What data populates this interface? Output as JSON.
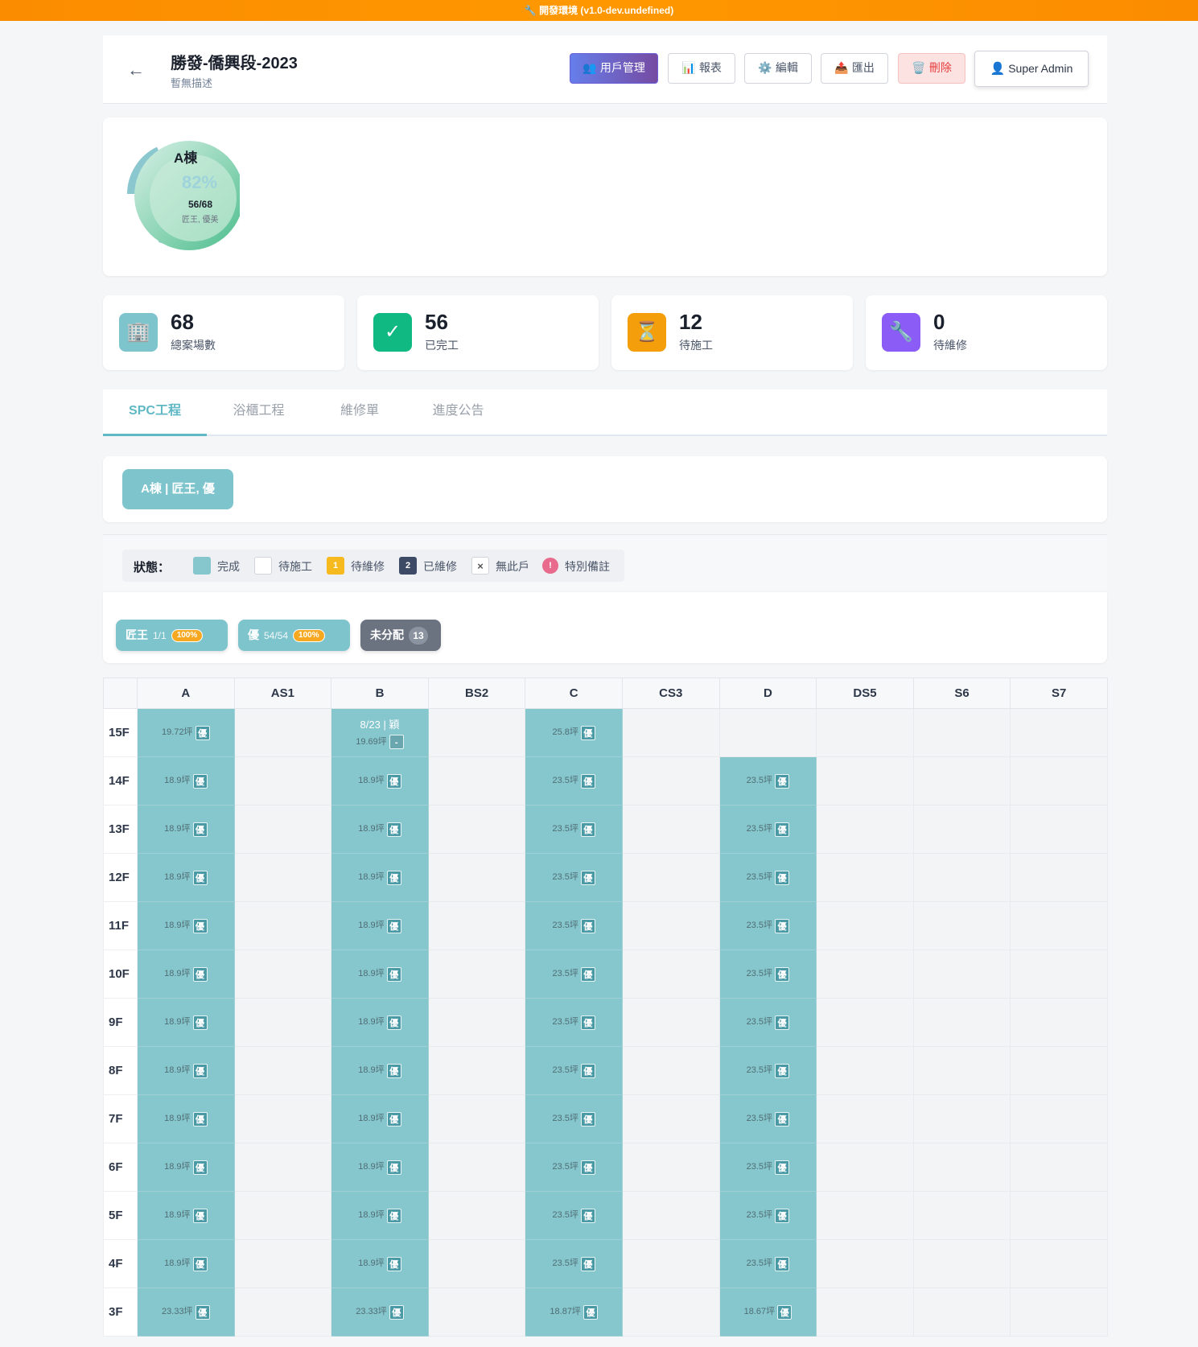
{
  "env_banner": "🔧 開發環境 (v1.0-dev.undefined)",
  "header": {
    "back": "←",
    "title": "勝發-僑興段-2023",
    "subtitle": "暫無描述",
    "buttons": {
      "users": "👥 用戶管理",
      "report": "📊 報表",
      "edit": "⚙️ 編輯",
      "export": "📤 匯出",
      "delete": "🗑️ 刪除",
      "admin_icon": "👤",
      "admin": "Super Admin"
    }
  },
  "building_card": {
    "name": "A棟",
    "percent": "82%",
    "count": "56/68",
    "teams": "匠王, 優美"
  },
  "stats": [
    {
      "icon": "🏢",
      "value": "68",
      "label": "總案場數",
      "color": "#7ec4cc"
    },
    {
      "icon": "✓",
      "value": "56",
      "label": "已完工",
      "color": "#10b981"
    },
    {
      "icon": "⏳",
      "value": "12",
      "label": "待施工",
      "color": "#f59e0b"
    },
    {
      "icon": "🔧",
      "value": "0",
      "label": "待維修",
      "color": "#8b5cf6"
    }
  ],
  "tabs": [
    "SPC工程",
    "浴櫃工程",
    "維修單",
    "進度公告"
  ],
  "building_selector": "A棟 | 匠王, 優",
  "legend": {
    "title": "狀態：",
    "items": [
      {
        "label": "完成"
      },
      {
        "label": "待施工"
      },
      {
        "label": "待維修",
        "mark": "1"
      },
      {
        "label": "已維修",
        "mark": "2"
      },
      {
        "label": "無此戶",
        "mark": "×"
      },
      {
        "label": "特別備註",
        "mark": "!"
      }
    ]
  },
  "teams": [
    {
      "name": "匠王",
      "count": "1/1",
      "percent": "100%"
    },
    {
      "name": "優",
      "count": "54/54",
      "percent": "100%"
    },
    {
      "name": "未分配",
      "count": "13"
    }
  ],
  "grid": {
    "columns": [
      "A",
      "AS1",
      "B",
      "BS2",
      "C",
      "CS3",
      "D",
      "DS5",
      "S6",
      "S7"
    ],
    "rows": [
      {
        "floor": "15F",
        "cells": [
          {
            "area": "19.72坪",
            "team": "優"
          },
          null,
          {
            "date": "8/23 | 穎",
            "area": "19.69坪",
            "team": "-"
          },
          null,
          {
            "area": "25.8坪",
            "team": "優"
          },
          null,
          "blank",
          null,
          null,
          null
        ]
      },
      {
        "floor": "14F",
        "cells": [
          {
            "area": "18.9坪",
            "team": "優"
          },
          null,
          {
            "area": "18.9坪",
            "team": "優"
          },
          null,
          {
            "area": "23.5坪",
            "team": "優"
          },
          null,
          {
            "area": "23.5坪",
            "team": "優"
          },
          null,
          null,
          null
        ]
      },
      {
        "floor": "13F",
        "cells": [
          {
            "area": "18.9坪",
            "team": "優"
          },
          null,
          {
            "area": "18.9坪",
            "team": "優"
          },
          null,
          {
            "area": "23.5坪",
            "team": "優"
          },
          null,
          {
            "area": "23.5坪",
            "team": "優"
          },
          null,
          null,
          null
        ]
      },
      {
        "floor": "12F",
        "cells": [
          {
            "area": "18.9坪",
            "team": "優"
          },
          null,
          {
            "area": "18.9坪",
            "team": "優"
          },
          null,
          {
            "area": "23.5坪",
            "team": "優"
          },
          null,
          {
            "area": "23.5坪",
            "team": "優"
          },
          null,
          null,
          null
        ]
      },
      {
        "floor": "11F",
        "cells": [
          {
            "area": "18.9坪",
            "team": "優"
          },
          null,
          {
            "area": "18.9坪",
            "team": "優"
          },
          null,
          {
            "area": "23.5坪",
            "team": "優"
          },
          null,
          {
            "area": "23.5坪",
            "team": "優"
          },
          null,
          null,
          null
        ]
      },
      {
        "floor": "10F",
        "cells": [
          {
            "area": "18.9坪",
            "team": "優"
          },
          null,
          {
            "area": "18.9坪",
            "team": "優"
          },
          null,
          {
            "area": "23.5坪",
            "team": "優"
          },
          null,
          {
            "area": "23.5坪",
            "team": "優"
          },
          null,
          null,
          null
        ]
      },
      {
        "floor": "9F",
        "cells": [
          {
            "area": "18.9坪",
            "team": "優"
          },
          null,
          {
            "area": "18.9坪",
            "team": "優"
          },
          null,
          {
            "area": "23.5坪",
            "team": "優"
          },
          null,
          {
            "area": "23.5坪",
            "team": "優"
          },
          null,
          null,
          null
        ]
      },
      {
        "floor": "8F",
        "cells": [
          {
            "area": "18.9坪",
            "team": "優"
          },
          null,
          {
            "area": "18.9坪",
            "team": "優"
          },
          null,
          {
            "area": "23.5坪",
            "team": "優"
          },
          null,
          {
            "area": "23.5坪",
            "team": "優"
          },
          null,
          null,
          null
        ]
      },
      {
        "floor": "7F",
        "cells": [
          {
            "area": "18.9坪",
            "team": "優"
          },
          null,
          {
            "area": "18.9坪",
            "team": "優"
          },
          null,
          {
            "area": "23.5坪",
            "team": "優"
          },
          null,
          {
            "area": "23.5坪",
            "team": "優"
          },
          null,
          null,
          null
        ]
      },
      {
        "floor": "6F",
        "cells": [
          {
            "area": "18.9坪",
            "team": "優"
          },
          null,
          {
            "area": "18.9坪",
            "team": "優"
          },
          null,
          {
            "area": "23.5坪",
            "team": "優"
          },
          null,
          {
            "area": "23.5坪",
            "team": "優"
          },
          null,
          null,
          null
        ]
      },
      {
        "floor": "5F",
        "cells": [
          {
            "area": "18.9坪",
            "team": "優"
          },
          null,
          {
            "area": "18.9坪",
            "team": "優"
          },
          null,
          {
            "area": "23.5坪",
            "team": "優"
          },
          null,
          {
            "area": "23.5坪",
            "team": "優"
          },
          null,
          null,
          null
        ]
      },
      {
        "floor": "4F",
        "cells": [
          {
            "area": "18.9坪",
            "team": "優"
          },
          null,
          {
            "area": "18.9坪",
            "team": "優"
          },
          null,
          {
            "area": "23.5坪",
            "team": "優"
          },
          null,
          {
            "area": "23.5坪",
            "team": "優"
          },
          null,
          null,
          null
        ]
      },
      {
        "floor": "3F",
        "cells": [
          {
            "area": "23.33坪",
            "team": "優"
          },
          null,
          {
            "area": "23.33坪",
            "team": "優"
          },
          null,
          {
            "area": "18.87坪",
            "team": "優"
          },
          null,
          {
            "area": "18.67坪",
            "team": "優"
          },
          null,
          null,
          null
        ]
      }
    ]
  }
}
